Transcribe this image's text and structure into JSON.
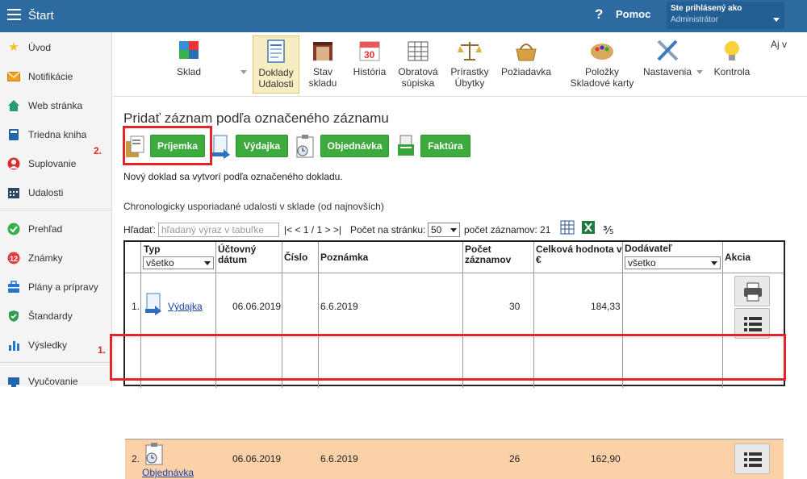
{
  "app": {
    "title": "Štart",
    "help_label": "Pomoc",
    "user_line1": "Ste prihlásený ako",
    "user_line2": "Administrátor"
  },
  "sidebar": {
    "items": [
      {
        "label": "Úvod",
        "icon": "star-icon",
        "color": "#f0c020"
      },
      {
        "label": "Notifikácie",
        "icon": "envelope-icon",
        "color": "#f0a020"
      },
      {
        "label": "Web stránka",
        "icon": "house-icon",
        "color": "#2a9a70"
      },
      {
        "label": "Triedna kniha",
        "icon": "book-icon",
        "color": "#2266aa"
      },
      {
        "label": "Suplovanie",
        "icon": "person-icon",
        "color": "#d83030"
      },
      {
        "label": "Udalosti",
        "icon": "calendar-icon",
        "color": "#334466"
      },
      {
        "label": "Prehľad",
        "icon": "check-circle-icon",
        "color": "#35b050"
      },
      {
        "label": "Známky",
        "icon": "grades-icon",
        "color": "#e04040"
      },
      {
        "label": "Plány a prípravy",
        "icon": "briefcase-icon",
        "color": "#2277cc"
      },
      {
        "label": "Štandardy",
        "icon": "shield-check-icon",
        "color": "#2aa050"
      },
      {
        "label": "Výsledky",
        "icon": "bar-chart-icon",
        "color": "#2277cc"
      },
      {
        "label": "Vyučovanie",
        "icon": "teaching-icon",
        "color": "#2266aa"
      }
    ]
  },
  "toolbar": {
    "items": [
      {
        "label": "Sklad",
        "icon": "cubes-icon"
      },
      {
        "label": "Doklady Udalosti",
        "line1": "Doklady",
        "line2": "Udalosti",
        "icon": "document-icon"
      },
      {
        "label": "Stav skladu",
        "line1": "Stav",
        "line2": "skladu",
        "icon": "warehouse-icon"
      },
      {
        "label": "História",
        "icon": "calendar-30-icon"
      },
      {
        "label": "Obratová súpiska",
        "line1": "Obratová",
        "line2": "súpiska",
        "icon": "table-icon"
      },
      {
        "label": "Prírastky Úbytky",
        "line1": "Prírastky",
        "line2": "Úbytky",
        "icon": "scales-icon"
      },
      {
        "label": "Požiadavka",
        "icon": "basket-icon"
      },
      {
        "label": "Položky Skladové karty",
        "line1": "Položky",
        "line2": "Skladové karty",
        "icon": "palette-icon"
      },
      {
        "label": "Nastavenia",
        "icon": "tools-icon"
      },
      {
        "label": "Kontrola",
        "icon": "lightbulb-icon"
      },
      {
        "label": "Aj v"
      }
    ]
  },
  "main": {
    "heading": "Pridať záznam podľa označeného záznamu",
    "buttons": [
      "Príjemka",
      "Výdajka",
      "Objednávka",
      "Faktúra"
    ],
    "note": "Nový doklad sa vytvorí podľa označeného dokladu.",
    "chron": "Chronologicky usporiadané udalosti v sklade (od najnovších)",
    "search_label": "Hľadať:",
    "search_placeholder": "hľadaný výraz v tabuľke",
    "pager": "|< < 1 / 1 > >|",
    "per_page_label": "Počet na stránku:",
    "per_page": "50",
    "count_label": "počet záznamov: 21",
    "fraction": "⅗"
  },
  "table": {
    "headers": {
      "typ": "Typ",
      "datum1": "Účtovný",
      "datum2": "dátum",
      "cislo": "Číslo",
      "poznamka": "Poznámka",
      "pocet1": "Počet",
      "pocet2": "záznamov",
      "hodnota1": "Celková hodnota v",
      "hodnota2": "€",
      "dodavatel": "Dodávateľ",
      "akcia": "Akcia"
    },
    "typ_filter": "všetko",
    "dodavatel_filter": "všetko",
    "rows": [
      {
        "n": "1.",
        "typ": "Výdajka",
        "datum": "06.06.2019",
        "cislo": "",
        "poznamka": "6.6.2019",
        "pocet": "30",
        "hodnota": "184,33",
        "dodavatel": ""
      },
      {
        "n": "2.",
        "typ": "Objednávka",
        "datum": "06.06.2019",
        "cislo": "",
        "poznamka": "6.6.2019",
        "pocet": "26",
        "hodnota": "162,90",
        "dodavatel": ""
      }
    ]
  },
  "annotations": {
    "label1": "1.",
    "label2": "2."
  },
  "colors": {
    "topbar": "#2c6aa0",
    "button_green": "#3daa3d",
    "highlight_row": "#fcd1a8",
    "annotation_red": "#e3242b"
  }
}
